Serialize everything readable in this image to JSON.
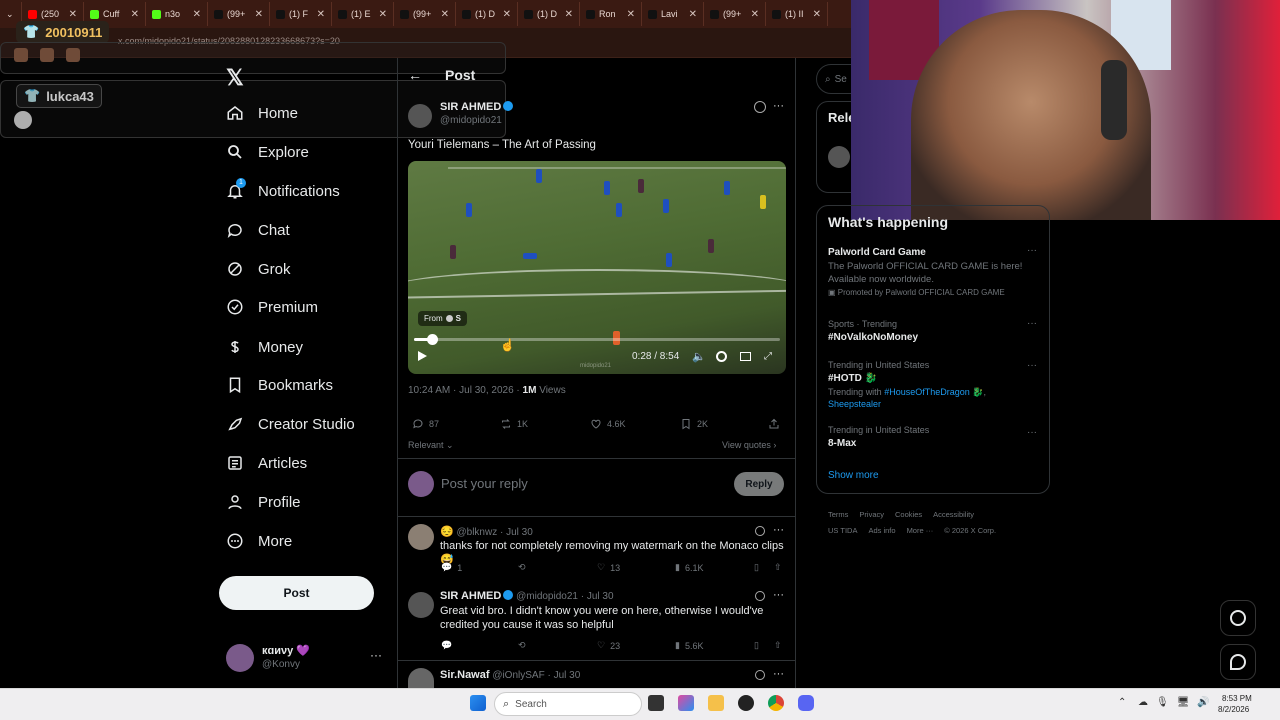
{
  "browser": {
    "tabs": [
      {
        "label": "(250",
        "color": "#ff0000"
      },
      {
        "label": "Cuff",
        "color": "#53fc18"
      },
      {
        "label": "n3o",
        "color": "#53fc18"
      },
      {
        "label": "(99+",
        "color": "#111111"
      },
      {
        "label": "(1) F",
        "color": "#111111"
      },
      {
        "label": "(1) E",
        "color": "#111111"
      },
      {
        "label": "(99+",
        "color": "#111111"
      },
      {
        "label": "(1) D",
        "color": "#111111"
      },
      {
        "label": "(1) D",
        "color": "#111111"
      },
      {
        "label": "Ron",
        "color": "#111111"
      },
      {
        "label": "Lavi",
        "color": "#111111"
      },
      {
        "label": "(99+",
        "color": "#111111"
      },
      {
        "label": "(1) II",
        "color": "#111111"
      }
    ],
    "url": "x.com/midopido21/status/2082880128233668673?s=20"
  },
  "stream_overlay": {
    "sub_count": "20010911",
    "viewer_name": "lukca43"
  },
  "nav": {
    "items": [
      {
        "label": "Home",
        "icon": "home-icon"
      },
      {
        "label": "Explore",
        "icon": "search-icon"
      },
      {
        "label": "Notifications",
        "icon": "bell-icon",
        "badge": "1"
      },
      {
        "label": "Chat",
        "icon": "chat-icon"
      },
      {
        "label": "Grok",
        "icon": "grok-icon"
      },
      {
        "label": "Premium",
        "icon": "verified-badge-icon"
      },
      {
        "label": "Money",
        "icon": "dollar-icon"
      },
      {
        "label": "Bookmarks",
        "icon": "bookmark-icon"
      },
      {
        "label": "Creator Studio",
        "icon": "rocket-icon"
      },
      {
        "label": "Articles",
        "icon": "article-icon"
      },
      {
        "label": "Profile",
        "icon": "person-icon"
      },
      {
        "label": "More",
        "icon": "more-circle-icon"
      }
    ],
    "post_button": "Post",
    "account": {
      "name": "кɑиνу 💜",
      "handle": "@Konvy"
    }
  },
  "post": {
    "header": "Post",
    "author": "SIR AHMED",
    "handle": "@midopido21",
    "text": "Youri Tielemans – The Art of Passing",
    "video": {
      "from_label": "From",
      "from_name": "S",
      "time": "0:28 / 8:54",
      "watermark": "midopido21",
      "progress": 0.05
    },
    "timestamp": "10:24 AM · Jul 30, 2026 · ",
    "views": "1M",
    "views_label": "Views",
    "stats": {
      "replies": "87",
      "reposts": "1K",
      "likes": "4.6K",
      "bookmarks": "2K"
    },
    "sort_label": "Relevant",
    "view_quotes": "View quotes",
    "reply_placeholder": "Post your reply",
    "reply_button": "Reply"
  },
  "replies": [
    {
      "name": "😔",
      "handle": "@blknwz",
      "date": "· Jul 30",
      "text": "thanks for not completely removing my watermark on the Monaco clips 😅",
      "replies": "1",
      "likes": "13",
      "views": "6.1K"
    },
    {
      "name": "SIR AHMED",
      "handle": "@midopido21",
      "date": "· Jul 30",
      "text": "Great vid bro. I didn't know you were on here, otherwise I would've credited you cause it was so helpful",
      "replies": "",
      "likes": "23",
      "views": "5.6K"
    },
    {
      "name": "Sir.Nawaf",
      "handle": "@iOnlySAF",
      "date": "· Jul 30"
    }
  ],
  "right": {
    "search_placeholder": "Se",
    "relevant_heading": "Rele",
    "whats_happening": "What's happening",
    "trends": [
      {
        "title": "Palworld Card Game",
        "desc": "The Palworld OFFICIAL CARD GAME is here! Available now worldwide.",
        "promo": "Promoted by Palworld OFFICIAL CARD GAME"
      },
      {
        "meta": "Sports · Trending",
        "title": "#NoValkoNoMoney"
      },
      {
        "meta": "Trending in United States",
        "title": "#HOTD",
        "with_prefix": "Trending with",
        "with1": "#HouseOfTheDragon",
        "with2": "Sheepstealer"
      },
      {
        "meta": "Trending in United States",
        "title": "8-Max"
      }
    ],
    "show_more": "Show more",
    "footer": [
      "Terms",
      "Privacy",
      "Cookies",
      "Accessibility",
      "US TIDA",
      "Ads info",
      "More ···",
      "© 2026 X Corp."
    ]
  },
  "taskbar": {
    "search_placeholder": "Search",
    "time": "8:53 PM",
    "date": "8/2/2026"
  }
}
